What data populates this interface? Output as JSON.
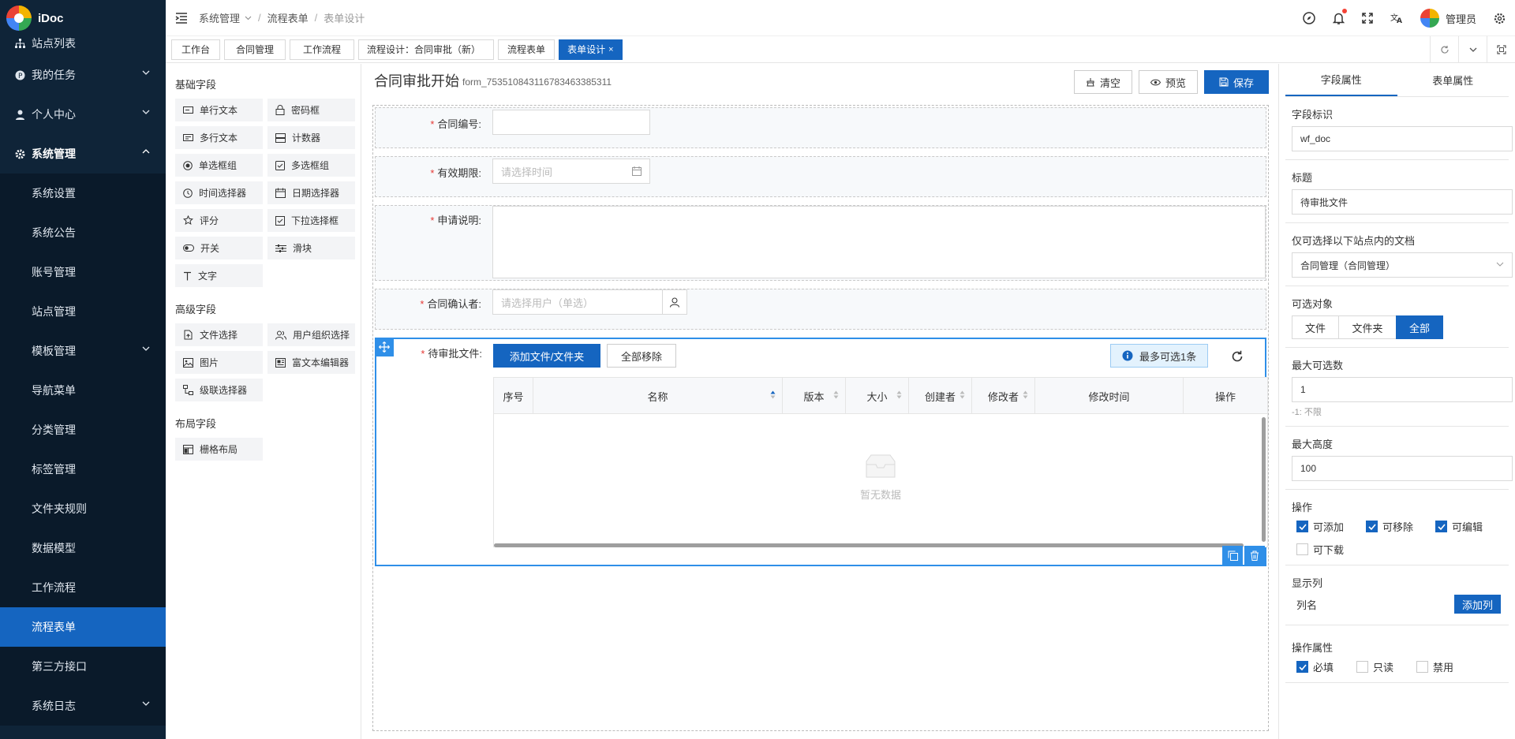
{
  "app": {
    "name": "iDoc",
    "user": "管理员"
  },
  "sidebar": {
    "items": [
      {
        "label": "站点列表"
      },
      {
        "label": "我的任务"
      },
      {
        "label": "个人中心"
      },
      {
        "label": "系统管理"
      },
      {
        "label": "系统设置"
      },
      {
        "label": "系统公告"
      },
      {
        "label": "账号管理"
      },
      {
        "label": "站点管理"
      },
      {
        "label": "模板管理"
      },
      {
        "label": "导航菜单"
      },
      {
        "label": "分类管理"
      },
      {
        "label": "标签管理"
      },
      {
        "label": "文件夹规则"
      },
      {
        "label": "数据模型"
      },
      {
        "label": "工作流程"
      },
      {
        "label": "流程表单"
      },
      {
        "label": "第三方接口"
      },
      {
        "label": "系统日志"
      }
    ]
  },
  "breadcrumb": [
    "系统管理",
    "流程表单",
    "表单设计"
  ],
  "tabs": [
    "工作台",
    "合同管理",
    "工作流程",
    "流程设计：合同审批（新）",
    "流程表单",
    "表单设计"
  ],
  "palette": {
    "basic_title": "基础字段",
    "basic": [
      "单行文本",
      "密码框",
      "多行文本",
      "计数器",
      "单选框组",
      "多选框组",
      "时间选择器",
      "日期选择器",
      "评分",
      "下拉选择框",
      "开关",
      "滑块",
      "文字"
    ],
    "advanced_title": "高级字段",
    "advanced": [
      "文件选择",
      "用户组织选择",
      "图片",
      "富文本编辑器",
      "级联选择器"
    ],
    "layout_title": "布局字段",
    "layout": [
      "栅格布局"
    ]
  },
  "form": {
    "title": "合同审批开始",
    "id": "form_753510843116783463385311",
    "buttons": {
      "clear": "清空",
      "preview": "预览",
      "save": "保存"
    },
    "fields": {
      "contract_no": {
        "label": "合同编号:",
        "value": ""
      },
      "valid_period": {
        "label": "有效期限:",
        "placeholder": "请选择时间"
      },
      "description": {
        "label": "申请说明:",
        "value": ""
      },
      "confirmer": {
        "label": "合同确认者:",
        "placeholder": "请选择用户（单选）"
      },
      "files": {
        "label": "待审批文件:",
        "add_btn": "添加文件/文件夹",
        "remove_btn": "全部移除",
        "max_badge": "最多可选1条",
        "columns": [
          "序号",
          "名称",
          "版本",
          "大小",
          "创建者",
          "修改者",
          "修改时间",
          "操作"
        ],
        "empty": "暂无数据"
      }
    }
  },
  "props": {
    "tabs": [
      "字段属性",
      "表单属性"
    ],
    "field_id": {
      "label": "字段标识",
      "value": "wf_doc"
    },
    "title": {
      "label": "标题",
      "value": "待审批文件"
    },
    "site": {
      "label": "仅可选择以下站点内的文档",
      "value": "合同管理（合同管理）"
    },
    "target": {
      "label": "可选对象",
      "options": [
        "文件",
        "文件夹",
        "全部"
      ],
      "selected": "全部"
    },
    "max_count": {
      "label": "最大可选数",
      "value": "1",
      "hint": "-1: 不限"
    },
    "max_height": {
      "label": "最大高度",
      "value": "100"
    },
    "actions": {
      "label": "操作",
      "items": [
        {
          "label": "可添加",
          "checked": true
        },
        {
          "label": "可移除",
          "checked": true
        },
        {
          "label": "可编辑",
          "checked": true
        },
        {
          "label": "可下载",
          "checked": false
        }
      ]
    },
    "columns": {
      "label": "显示列",
      "col_name": "列名",
      "add_btn": "添加列"
    },
    "op_props": {
      "label": "操作属性",
      "items": [
        {
          "label": "必填",
          "checked": true
        },
        {
          "label": "只读",
          "checked": false
        },
        {
          "label": "禁用",
          "checked": false
        }
      ]
    }
  },
  "colors": {
    "primary": "#1565c0",
    "sidebar": "#0f2438",
    "selected_border": "#2f8fe8",
    "required": "#e53935"
  }
}
